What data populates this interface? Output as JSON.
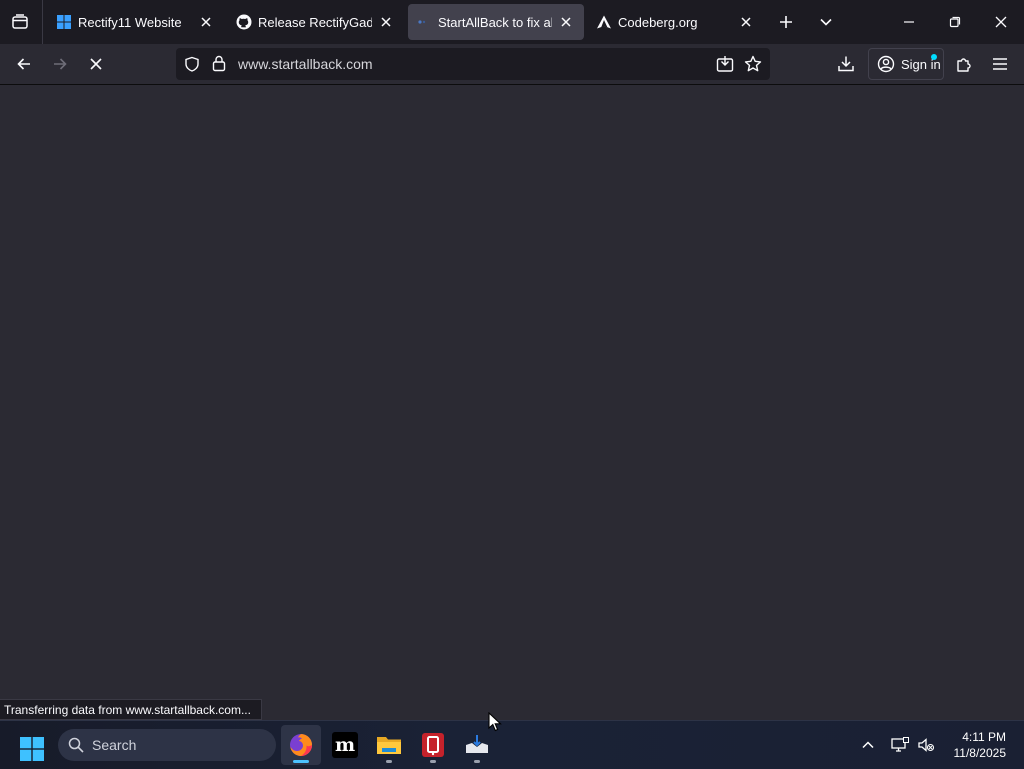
{
  "browser": {
    "tabs": [
      {
        "title": "Rectify11 Website",
        "favicon": "windows-logo-icon",
        "active": false
      },
      {
        "title": "Release RectifyGadgets",
        "favicon": "github-icon",
        "active": false
      },
      {
        "title": "StartAllBack to fix all W",
        "favicon": "loading-icon",
        "active": true
      },
      {
        "title": "Codeberg.org",
        "favicon": "codeberg-icon",
        "active": false
      }
    ],
    "address": {
      "url": "www.startallback.com"
    },
    "sign_in_label": "Sign in",
    "status_text": "Transferring data from www.startallback.com..."
  },
  "taskbar": {
    "search_label": "Search",
    "apps": [
      {
        "name": "firefox-icon",
        "active": true
      },
      {
        "name": "mastodon-m-icon",
        "active": false
      },
      {
        "name": "file-explorer-icon",
        "active": false
      },
      {
        "name": "red-app-icon",
        "active": false
      },
      {
        "name": "installer-icon",
        "active": false
      }
    ],
    "clock": {
      "time": "4:11 PM",
      "date": "11/8/2025"
    }
  },
  "colors": {
    "accent": "#4cc2ff",
    "chrome_bg": "#1c1b22",
    "toolbar_bg": "#2b2a33",
    "active_tab": "#42414d"
  }
}
